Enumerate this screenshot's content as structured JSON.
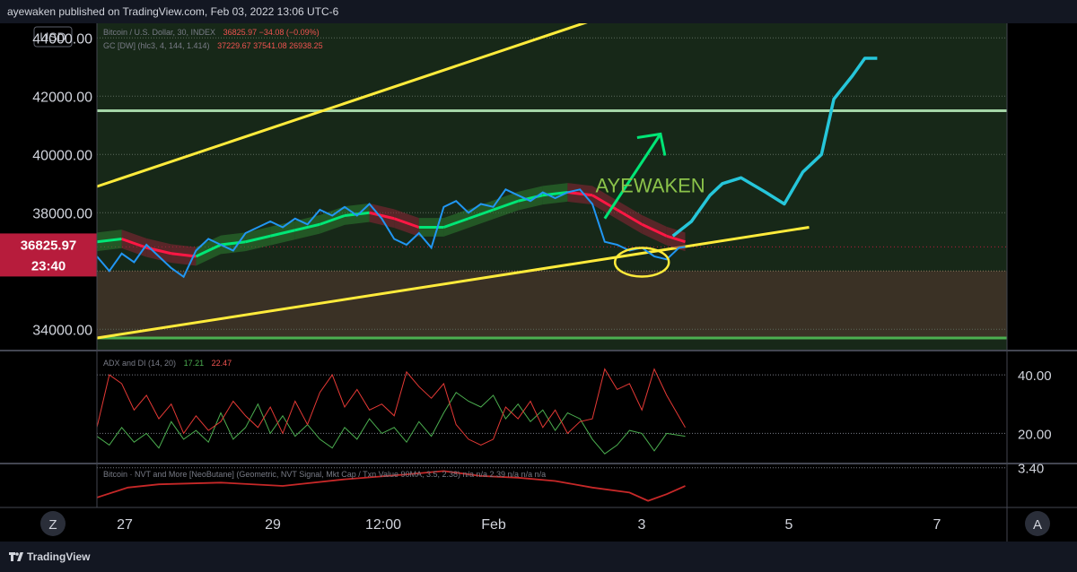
{
  "header": {
    "publish_text": "ayewaken published on TradingView.com, Feb 03, 2022 13:06 UTC-6"
  },
  "footer": {
    "brand": "TradingView"
  },
  "colors": {
    "price": "#2196f3",
    "channel": "#ffeb3b",
    "annotation": "#26c6da",
    "arrow": "#00e676",
    "level": "#a5d6a7",
    "bull": "#00e676",
    "bear": "#ff1744",
    "adx": "#4caf50",
    "di_minus": "#e53935",
    "badge": "#b71c3c",
    "watermark": "#8bc34a"
  },
  "chart_data": {
    "type": "line",
    "legend": {
      "currency": "USD",
      "symbol_text": "Bitcoin / U.S. Dollar, 30, INDEX",
      "symbol_values": "36825.97  −34.08 (−0.09%)",
      "gc_text": "GC [DW] (hlc3, 4, 144, 1.414)",
      "gc_values": "37229.67  37541.08  26938.25"
    },
    "watermark": "AYEWAKEN",
    "price_axis": {
      "ticks": [
        "44000.00",
        "42000.00",
        "40000.00",
        "38000.00",
        "34000.00"
      ],
      "ylim": [
        33300,
        44500
      ]
    },
    "last_price": {
      "value": "36825.97",
      "countdown": "23:40"
    },
    "time_axis": {
      "labels": [
        "27",
        "29",
        "12:00",
        "Feb",
        "3",
        "5",
        "7"
      ],
      "left_button": "Z",
      "right_button": "A"
    },
    "levels": {
      "resistance": 41500,
      "support": 33700,
      "zone": [
        33700,
        36000
      ]
    },
    "price_series": [
      [
        0,
        36500
      ],
      [
        2,
        36000
      ],
      [
        4,
        36600
      ],
      [
        6,
        36300
      ],
      [
        8,
        36900
      ],
      [
        10,
        36500
      ],
      [
        12,
        36100
      ],
      [
        14,
        35800
      ],
      [
        16,
        36700
      ],
      [
        18,
        37100
      ],
      [
        20,
        36900
      ],
      [
        22,
        36700
      ],
      [
        24,
        37300
      ],
      [
        26,
        37500
      ],
      [
        28,
        37700
      ],
      [
        30,
        37500
      ],
      [
        32,
        37800
      ],
      [
        34,
        37600
      ],
      [
        36,
        38100
      ],
      [
        38,
        37900
      ],
      [
        40,
        38200
      ],
      [
        42,
        37900
      ],
      [
        44,
        38300
      ],
      [
        46,
        37800
      ],
      [
        48,
        37100
      ],
      [
        50,
        36900
      ],
      [
        52,
        37300
      ],
      [
        54,
        36800
      ],
      [
        56,
        38200
      ],
      [
        58,
        38400
      ],
      [
        60,
        38000
      ],
      [
        62,
        38300
      ],
      [
        64,
        38200
      ],
      [
        66,
        38800
      ],
      [
        68,
        38600
      ],
      [
        70,
        38400
      ],
      [
        72,
        38700
      ],
      [
        74,
        38500
      ],
      [
        76,
        38700
      ],
      [
        78,
        38800
      ],
      [
        80,
        38300
      ],
      [
        82,
        37000
      ],
      [
        84,
        36900
      ],
      [
        86,
        36700
      ],
      [
        88,
        36800
      ],
      [
        90,
        36500
      ],
      [
        92,
        36400
      ],
      [
        94,
        36800
      ],
      [
        95,
        36826
      ]
    ],
    "guppy_band": [
      [
        0,
        37000
      ],
      [
        4,
        37100
      ],
      [
        8,
        36800
      ],
      [
        12,
        36600
      ],
      [
        16,
        36500
      ],
      [
        20,
        36900
      ],
      [
        24,
        37000
      ],
      [
        28,
        37200
      ],
      [
        32,
        37400
      ],
      [
        36,
        37600
      ],
      [
        40,
        37900
      ],
      [
        44,
        38000
      ],
      [
        48,
        37800
      ],
      [
        52,
        37500
      ],
      [
        56,
        37500
      ],
      [
        60,
        37800
      ],
      [
        64,
        38100
      ],
      [
        68,
        38400
      ],
      [
        72,
        38600
      ],
      [
        76,
        38700
      ],
      [
        80,
        38600
      ],
      [
        84,
        38100
      ],
      [
        88,
        37600
      ],
      [
        92,
        37200
      ],
      [
        95,
        37000
      ]
    ],
    "channel_upper": [
      [
        0,
        38900
      ],
      [
        80,
        44600
      ]
    ],
    "channel_lower": [
      [
        0,
        33700
      ],
      [
        115,
        37500
      ]
    ],
    "projection": [
      [
        93,
        37200
      ],
      [
        96,
        37700
      ],
      [
        99,
        38600
      ],
      [
        101,
        39000
      ],
      [
        104,
        39200
      ],
      [
        108,
        38700
      ],
      [
        111,
        38300
      ],
      [
        114,
        39400
      ],
      [
        117,
        40000
      ],
      [
        119,
        41900
      ],
      [
        122,
        42700
      ],
      [
        124,
        43300
      ],
      [
        126,
        43300
      ]
    ],
    "target_arrow": [
      [
        82,
        37800
      ],
      [
        91,
        40700
      ]
    ],
    "highlight_circle": {
      "x": 88,
      "y": 36300
    },
    "adx": {
      "label": "ADX and DI (14, 20)",
      "plus_value": "17.21",
      "minus_value": "22.47",
      "ticks": [
        "40.00",
        "20.00"
      ],
      "ylim": [
        10,
        48
      ],
      "di_minus": [
        [
          0,
          22
        ],
        [
          2,
          40
        ],
        [
          4,
          37
        ],
        [
          6,
          28
        ],
        [
          8,
          33
        ],
        [
          10,
          25
        ],
        [
          12,
          30
        ],
        [
          14,
          20
        ],
        [
          16,
          26
        ],
        [
          18,
          21
        ],
        [
          20,
          24
        ],
        [
          22,
          31
        ],
        [
          24,
          26
        ],
        [
          26,
          22
        ],
        [
          28,
          29
        ],
        [
          30,
          20
        ],
        [
          32,
          31
        ],
        [
          34,
          23
        ],
        [
          36,
          34
        ],
        [
          38,
          40
        ],
        [
          40,
          29
        ],
        [
          42,
          35
        ],
        [
          44,
          28
        ],
        [
          46,
          30
        ],
        [
          48,
          26
        ],
        [
          50,
          41
        ],
        [
          52,
          36
        ],
        [
          54,
          32
        ],
        [
          56,
          37
        ],
        [
          58,
          23
        ],
        [
          60,
          18
        ],
        [
          62,
          16
        ],
        [
          64,
          18
        ],
        [
          66,
          29
        ],
        [
          68,
          25
        ],
        [
          70,
          31
        ],
        [
          72,
          22
        ],
        [
          74,
          28
        ],
        [
          76,
          20
        ],
        [
          78,
          24
        ],
        [
          80,
          25
        ],
        [
          82,
          42
        ],
        [
          84,
          35
        ],
        [
          86,
          37
        ],
        [
          88,
          28
        ],
        [
          90,
          42
        ],
        [
          92,
          33
        ],
        [
          95,
          22
        ]
      ],
      "di_plus": [
        [
          0,
          19
        ],
        [
          2,
          16
        ],
        [
          4,
          22
        ],
        [
          6,
          17
        ],
        [
          8,
          20
        ],
        [
          10,
          15
        ],
        [
          12,
          24
        ],
        [
          14,
          18
        ],
        [
          16,
          21
        ],
        [
          18,
          17
        ],
        [
          20,
          27
        ],
        [
          22,
          18
        ],
        [
          24,
          22
        ],
        [
          26,
          30
        ],
        [
          28,
          20
        ],
        [
          30,
          26
        ],
        [
          32,
          19
        ],
        [
          34,
          23
        ],
        [
          36,
          18
        ],
        [
          38,
          15
        ],
        [
          40,
          22
        ],
        [
          42,
          18
        ],
        [
          44,
          25
        ],
        [
          46,
          20
        ],
        [
          48,
          22
        ],
        [
          50,
          17
        ],
        [
          52,
          24
        ],
        [
          54,
          19
        ],
        [
          56,
          27
        ],
        [
          58,
          34
        ],
        [
          60,
          31
        ],
        [
          62,
          29
        ],
        [
          64,
          33
        ],
        [
          66,
          25
        ],
        [
          68,
          30
        ],
        [
          70,
          24
        ],
        [
          72,
          28
        ],
        [
          74,
          21
        ],
        [
          76,
          27
        ],
        [
          78,
          25
        ],
        [
          80,
          18
        ],
        [
          82,
          13
        ],
        [
          84,
          16
        ],
        [
          86,
          21
        ],
        [
          88,
          20
        ],
        [
          90,
          14
        ],
        [
          92,
          20
        ],
        [
          95,
          19
        ]
      ]
    },
    "nvt": {
      "label": "Bitcoin · NVT and More [NeoButane] (Geometric, NVT Signal, Mkt Cap / Txn Value 90MA, 3.5, 2.38)  n/a  n/a  2.39  n/a  n/a  n/a",
      "tick": "3.40",
      "ylim": [
        2.2,
        3.5
      ],
      "series": [
        [
          0,
          2.5
        ],
        [
          5,
          2.8
        ],
        [
          10,
          2.9
        ],
        [
          20,
          2.95
        ],
        [
          30,
          2.85
        ],
        [
          40,
          3.05
        ],
        [
          50,
          3.2
        ],
        [
          56,
          3.3
        ],
        [
          62,
          3.15
        ],
        [
          68,
          3.1
        ],
        [
          74,
          3.0
        ],
        [
          80,
          2.8
        ],
        [
          86,
          2.65
        ],
        [
          89,
          2.4
        ],
        [
          92,
          2.6
        ],
        [
          95,
          2.85
        ]
      ]
    }
  }
}
